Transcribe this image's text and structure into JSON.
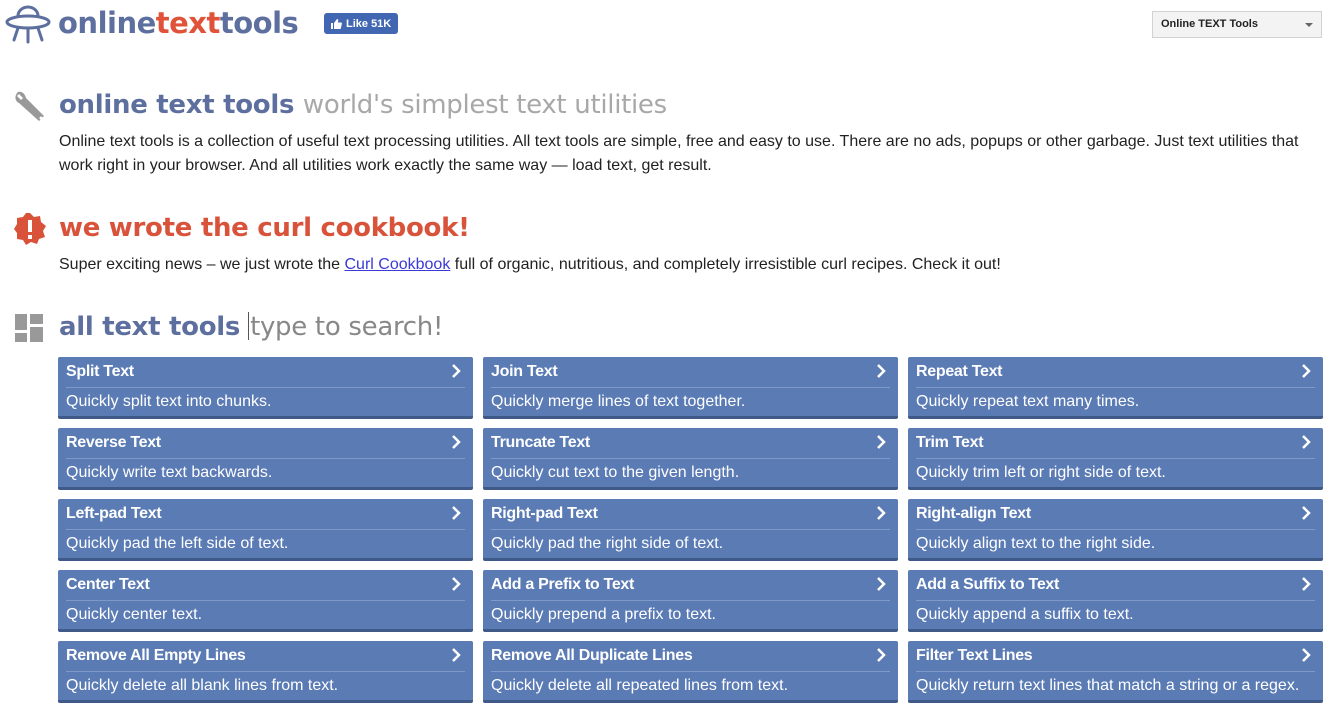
{
  "header": {
    "logo_part1": "online",
    "logo_part2": "text",
    "logo_part3": "tools",
    "like_label": "Like 51K",
    "site_select_value": "Online TEXT Tools"
  },
  "intro": {
    "title": "online text tools",
    "subtitle": "world's simplest text utilities",
    "text": "Online text tools is a collection of useful text processing utilities. All text tools are simple, free and easy to use. There are no ads, popups or other garbage. Just text utilities that work right in your browser. And all utilities work exactly the same way — load text, get result."
  },
  "news": {
    "title": "we wrote the curl cookbook!",
    "text_before": "Super exciting news – we just wrote the ",
    "link": "Curl Cookbook",
    "text_after": " full of organic, nutritious, and completely irresistible curl recipes. Check it out!"
  },
  "tools": {
    "title": "all text tools",
    "search_placeholder": "type to search!",
    "items": [
      {
        "title": "Split Text",
        "desc": "Quickly split text into chunks."
      },
      {
        "title": "Join Text",
        "desc": "Quickly merge lines of text together."
      },
      {
        "title": "Repeat Text",
        "desc": "Quickly repeat text many times."
      },
      {
        "title": "Reverse Text",
        "desc": "Quickly write text backwards."
      },
      {
        "title": "Truncate Text",
        "desc": "Quickly cut text to the given length."
      },
      {
        "title": "Trim Text",
        "desc": "Quickly trim left or right side of text."
      },
      {
        "title": "Left-pad Text",
        "desc": "Quickly pad the left side of text."
      },
      {
        "title": "Right-pad Text",
        "desc": "Quickly pad the right side of text."
      },
      {
        "title": "Right-align Text",
        "desc": "Quickly align text to the right side."
      },
      {
        "title": "Center Text",
        "desc": "Quickly center text."
      },
      {
        "title": "Add a Prefix to Text",
        "desc": "Quickly prepend a prefix to text."
      },
      {
        "title": "Add a Suffix to Text",
        "desc": "Quickly append a suffix to text."
      },
      {
        "title": "Remove All Empty Lines",
        "desc": "Quickly delete all blank lines from text."
      },
      {
        "title": "Remove All Duplicate Lines",
        "desc": "Quickly delete all repeated lines from text."
      },
      {
        "title": "Filter Text Lines",
        "desc": "Quickly return text lines that match a string or a regex."
      }
    ]
  },
  "colors": {
    "brand_blue": "#5d6f9e",
    "brand_red": "#e0533a",
    "card_bg": "#5b7bb5"
  }
}
